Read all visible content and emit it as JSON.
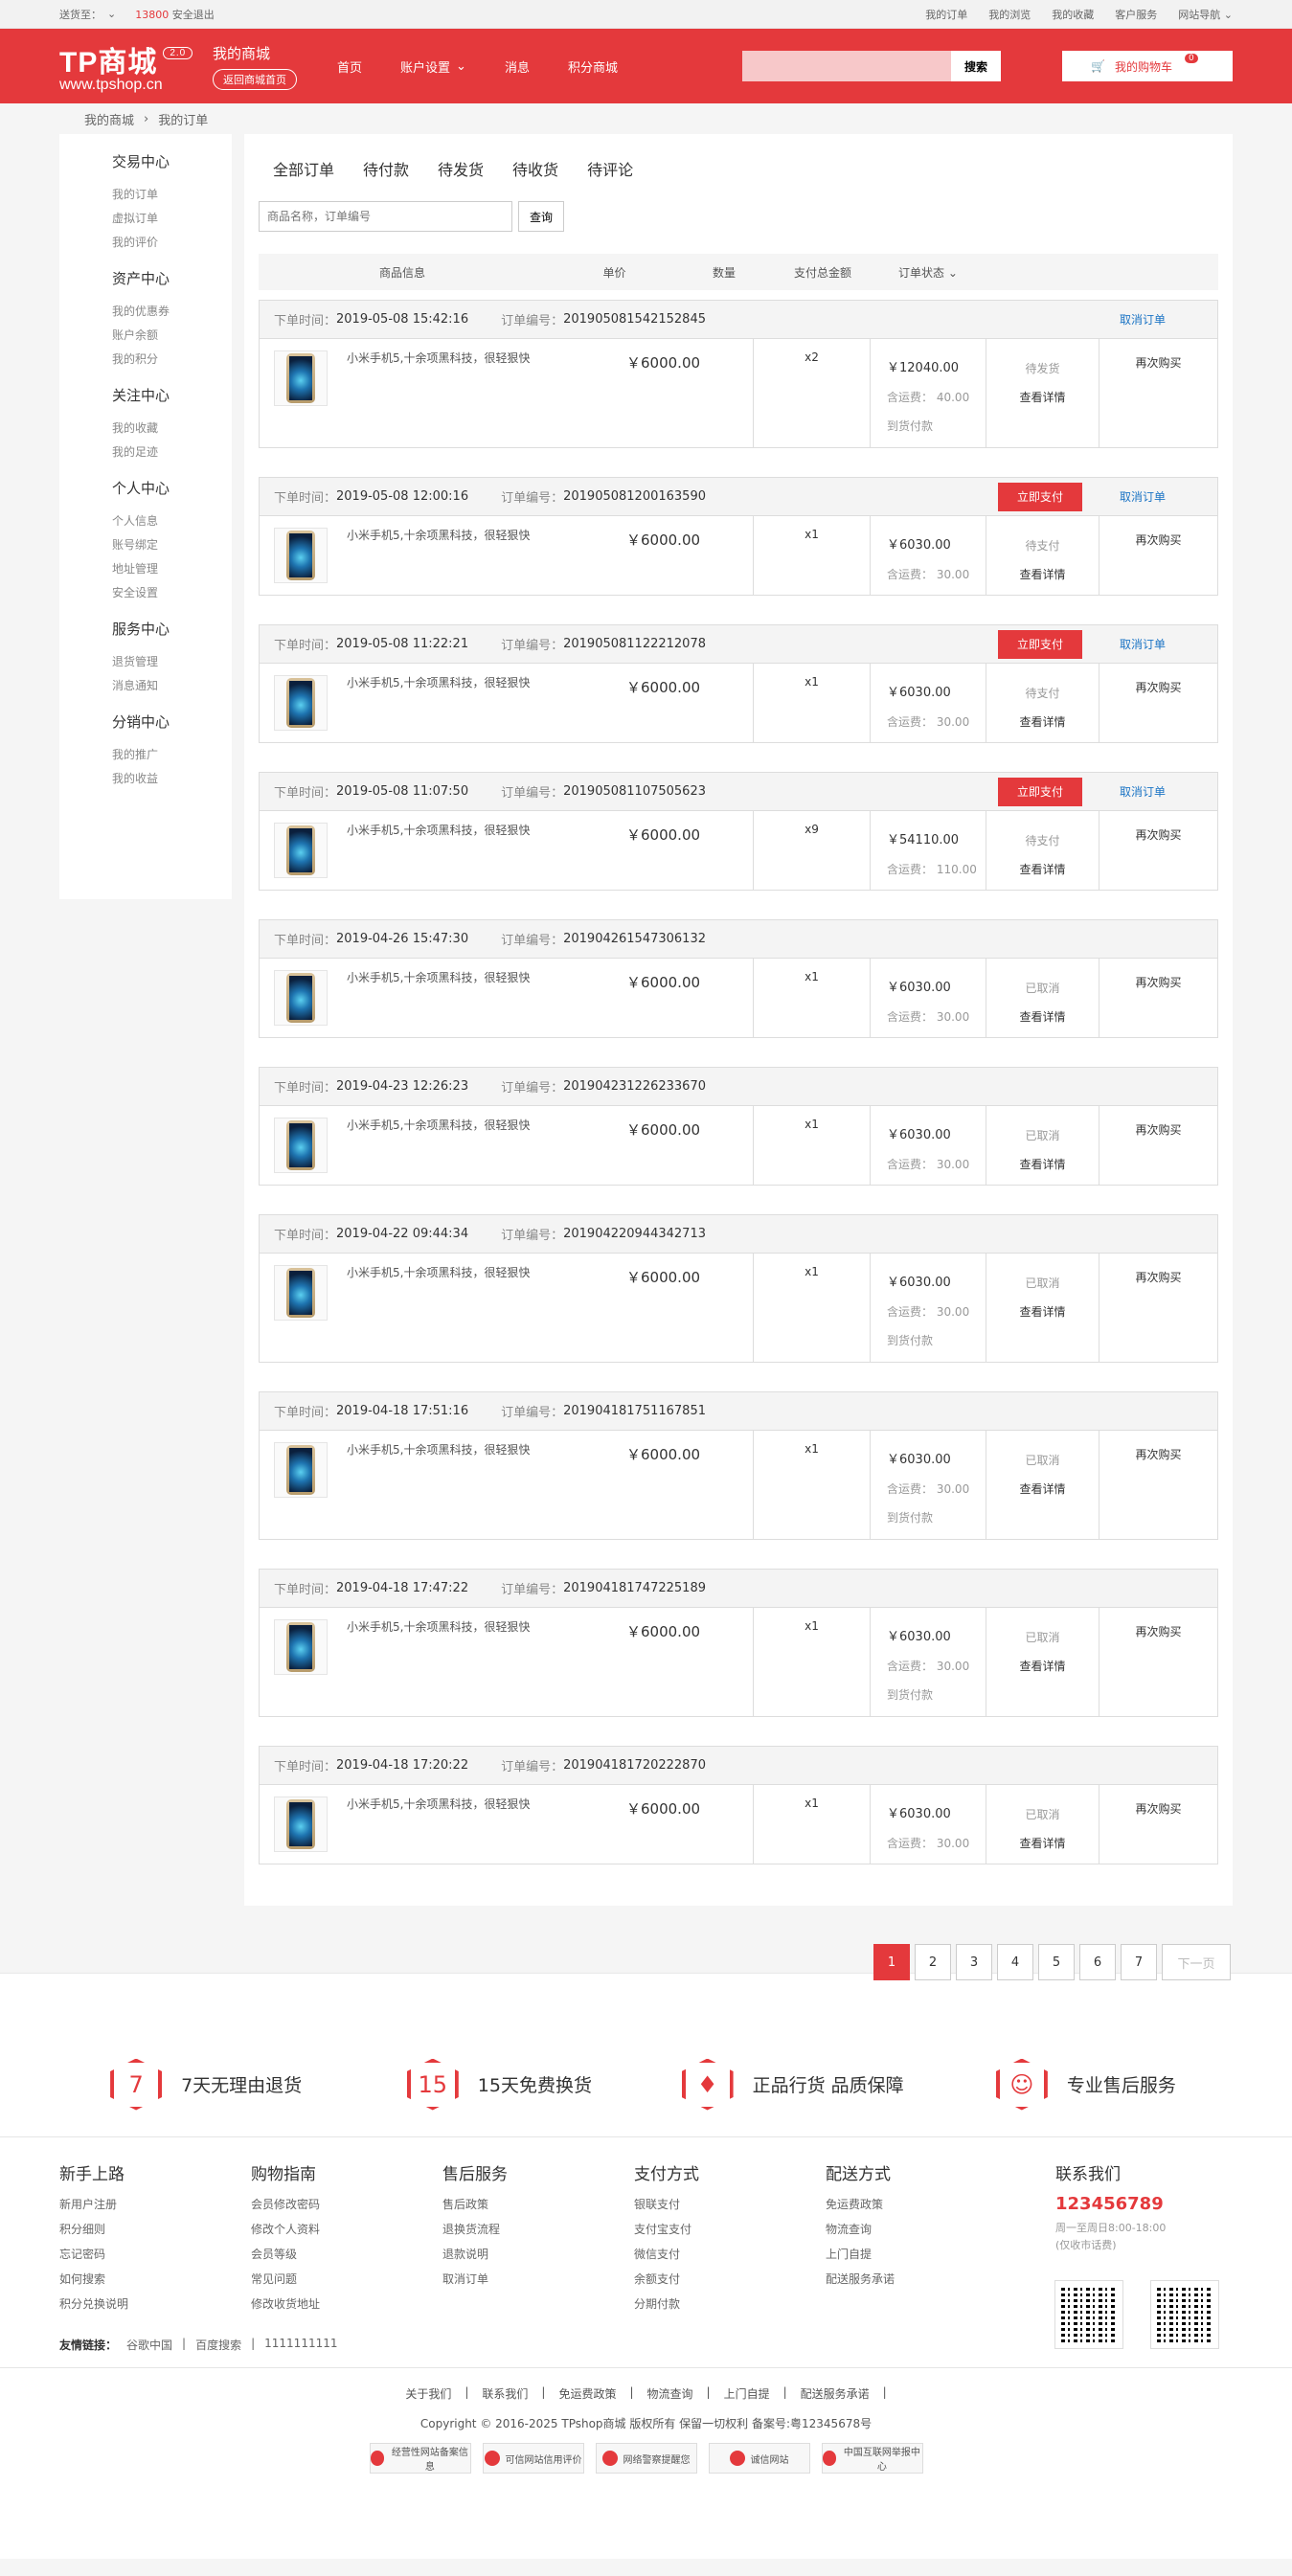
{
  "topbar": {
    "deliver_label": "送货至：",
    "user": "13800",
    "logout": "安全退出",
    "links": [
      "我的订单",
      "我的浏览",
      "我的收藏",
      "客户服务",
      "网站导航"
    ]
  },
  "header": {
    "logo": "TP商城",
    "version": "2.0",
    "site": "www.tpshop.cn",
    "my_mall": "我的商城",
    "back_home": "返回商城首页",
    "nav": [
      "首页",
      "账户设置",
      "消息",
      "积分商城"
    ],
    "search_placeholder": "",
    "search_button": "搜索",
    "cart": "我的购物车",
    "cart_count": "0"
  },
  "breadcrumb": [
    "我的商城",
    "我的订单"
  ],
  "sidebar": [
    {
      "title": "交易中心",
      "items": [
        "我的订单",
        "虚拟订单",
        "我的评价"
      ]
    },
    {
      "title": "资产中心",
      "items": [
        "我的优惠券",
        "账户余额",
        "我的积分"
      ]
    },
    {
      "title": "关注中心",
      "items": [
        "我的收藏",
        "我的足迹"
      ]
    },
    {
      "title": "个人中心",
      "items": [
        "个人信息",
        "账号绑定",
        "地址管理",
        "安全设置"
      ]
    },
    {
      "title": "服务中心",
      "items": [
        "退货管理",
        "消息通知"
      ]
    },
    {
      "title": "分销中心",
      "items": [
        "我的推广",
        "我的收益"
      ]
    }
  ],
  "tabs": [
    "全部订单",
    "待付款",
    "待发货",
    "待收货",
    "待评论"
  ],
  "query": {
    "placeholder": "商品名称，订单编号",
    "button": "查询"
  },
  "table_head": [
    "商品信息",
    "单价",
    "数量",
    "支付总金额",
    "订单状态"
  ],
  "labels": {
    "time": "下单时间：",
    "number": "订单编号：",
    "pay": "立即支付",
    "cancel": "取消订单",
    "detail": "查看详情",
    "rebuy": "再次购买",
    "freight": "含运费：",
    "cod": "到货付款"
  },
  "orders": [
    {
      "time": "2019-05-08 15:42:16",
      "no": "201905081542152845",
      "pay": false,
      "cancel": true,
      "name": "小米手机5,十余项黑科技，很轻狠快",
      "price": "￥6000.00",
      "qty": "x2",
      "total": "￥12040.00",
      "freight": "40.00",
      "cod": true,
      "status": "待发货"
    },
    {
      "time": "2019-05-08 12:00:16",
      "no": "201905081200163590",
      "pay": true,
      "cancel": true,
      "name": "小米手机5,十余项黑科技，很轻狠快",
      "price": "￥6000.00",
      "qty": "x1",
      "total": "￥6030.00",
      "freight": "30.00",
      "cod": false,
      "status": "待支付"
    },
    {
      "time": "2019-05-08 11:22:21",
      "no": "201905081122212078",
      "pay": true,
      "cancel": true,
      "name": "小米手机5,十余项黑科技，很轻狠快",
      "price": "￥6000.00",
      "qty": "x1",
      "total": "￥6030.00",
      "freight": "30.00",
      "cod": false,
      "status": "待支付"
    },
    {
      "time": "2019-05-08 11:07:50",
      "no": "201905081107505623",
      "pay": true,
      "cancel": true,
      "name": "小米手机5,十余项黑科技，很轻狠快",
      "price": "￥6000.00",
      "qty": "x9",
      "total": "￥54110.00",
      "freight": "110.00",
      "cod": false,
      "status": "待支付"
    },
    {
      "time": "2019-04-26 15:47:30",
      "no": "201904261547306132",
      "pay": false,
      "cancel": false,
      "name": "小米手机5,十余项黑科技，很轻狠快",
      "price": "￥6000.00",
      "qty": "x1",
      "total": "￥6030.00",
      "freight": "30.00",
      "cod": false,
      "status": "已取消"
    },
    {
      "time": "2019-04-23 12:26:23",
      "no": "201904231226233670",
      "pay": false,
      "cancel": false,
      "name": "小米手机5,十余项黑科技，很轻狠快",
      "price": "￥6000.00",
      "qty": "x1",
      "total": "￥6030.00",
      "freight": "30.00",
      "cod": false,
      "status": "已取消"
    },
    {
      "time": "2019-04-22 09:44:34",
      "no": "201904220944342713",
      "pay": false,
      "cancel": false,
      "name": "小米手机5,十余项黑科技，很轻狠快",
      "price": "￥6000.00",
      "qty": "x1",
      "total": "￥6030.00",
      "freight": "30.00",
      "cod": true,
      "status": "已取消"
    },
    {
      "time": "2019-04-18 17:51:16",
      "no": "201904181751167851",
      "pay": false,
      "cancel": false,
      "name": "小米手机5,十余项黑科技，很轻狠快",
      "price": "￥6000.00",
      "qty": "x1",
      "total": "￥6030.00",
      "freight": "30.00",
      "cod": true,
      "status": "已取消"
    },
    {
      "time": "2019-04-18 17:47:22",
      "no": "201904181747225189",
      "pay": false,
      "cancel": false,
      "name": "小米手机5,十余项黑科技，很轻狠快",
      "price": "￥6000.00",
      "qty": "x1",
      "total": "￥6030.00",
      "freight": "30.00",
      "cod": true,
      "status": "已取消"
    },
    {
      "time": "2019-04-18 17:20:22",
      "no": "201904181720222870",
      "pay": false,
      "cancel": false,
      "name": "小米手机5,十余项黑科技，很轻狠快",
      "price": "￥6000.00",
      "qty": "x1",
      "total": "￥6030.00",
      "freight": "30.00",
      "cod": false,
      "status": "已取消"
    }
  ],
  "pager": [
    "1",
    "2",
    "3",
    "4",
    "5",
    "6",
    "7"
  ],
  "pager_next": "下一页",
  "promise": [
    {
      "icon": "7",
      "text": "7天无理由退货"
    },
    {
      "icon": "15",
      "text": "15天免费换货"
    },
    {
      "icon": "♦",
      "text": "正品行货 品质保障"
    },
    {
      "icon": "☺",
      "text": "专业售后服务"
    }
  ],
  "footer_cols": [
    {
      "title": "新手上路",
      "items": [
        "新用户注册",
        "积分细则",
        "忘记密码",
        "如何搜索",
        "积分兑换说明"
      ]
    },
    {
      "title": "购物指南",
      "items": [
        "会员修改密码",
        "修改个人资料",
        "会员等级",
        "常见问题",
        "修改收货地址"
      ]
    },
    {
      "title": "售后服务",
      "items": [
        "售后政策",
        "退换货流程",
        "退款说明",
        "取消订单"
      ]
    },
    {
      "title": "支付方式",
      "items": [
        "银联支付",
        "支付宝支付",
        "微信支付",
        "余额支付",
        "分期付款"
      ]
    },
    {
      "title": "配送方式",
      "items": [
        "免运费政策",
        "物流查询",
        "上门自提",
        "配送服务承诺"
      ]
    }
  ],
  "contact": {
    "title": "联系我们",
    "tel": "123456789",
    "time": "周一至周日8:00-18:00",
    "note": "(仅收市话费)"
  },
  "friends": {
    "label": "友情链接：",
    "links": [
      "谷歌中国",
      "百度搜索",
      "1111111111"
    ]
  },
  "bottom_links": [
    "关于我们",
    "联系我们",
    "免运费政策",
    "物流查询",
    "上门自提",
    "配送服务承诺"
  ],
  "copyright": "Copyright © 2016-2025 TPshop商城 版权所有 保留一切权利 备案号:粤12345678号",
  "badges": [
    "经营性网站备案信息",
    "可信网站信用评价",
    "网络警察提醒您",
    "诚信网站",
    "中国互联网举报中心"
  ]
}
